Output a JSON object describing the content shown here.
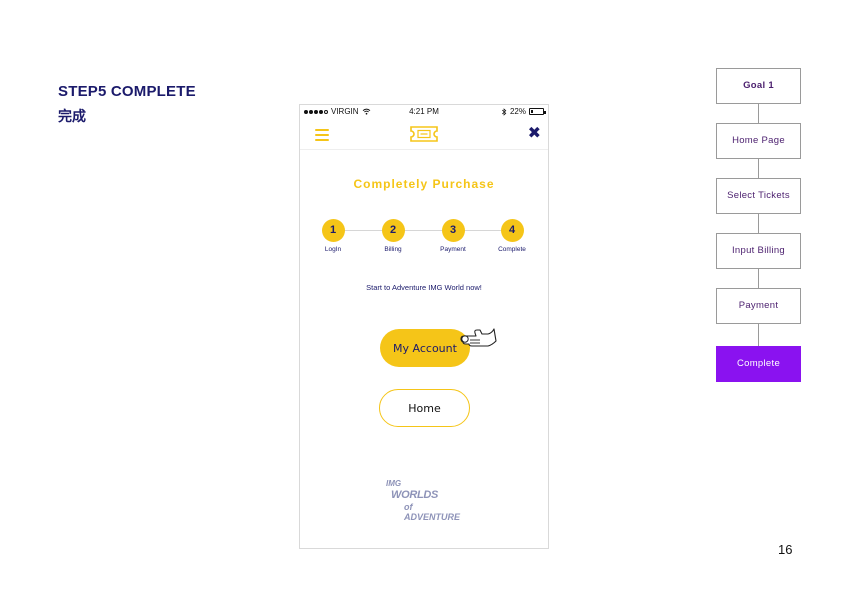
{
  "slide": {
    "title": "STEP5 COMPLETE",
    "subtitle": "完成",
    "page_number": "16"
  },
  "phone": {
    "status_bar": {
      "carrier": "VIRGIN",
      "time": "4:21 PM",
      "battery": "22%",
      "battery_level": 0.22
    },
    "heading": "Completely Purchase",
    "steps": [
      {
        "number": "1",
        "label": "LogIn"
      },
      {
        "number": "2",
        "label": "Billing"
      },
      {
        "number": "3",
        "label": "Payment"
      },
      {
        "number": "4",
        "label": "Complete"
      }
    ],
    "tagline": "Start to Adventure IMG World now!",
    "primary_button": "My Account",
    "secondary_button": "Home",
    "brand": {
      "line1": "IMG",
      "line2": "WORLDS",
      "line3": "of ADVENTURE"
    },
    "icons": {
      "menu": "hamburger-menu-icon",
      "logo": "ticket-icon",
      "close": "close-icon",
      "pointer": "hand-pointer-icon"
    }
  },
  "flow": [
    {
      "label": "Goal 1",
      "state": "goal"
    },
    {
      "label": "Home Page",
      "state": "normal"
    },
    {
      "label": "Select Tickets",
      "state": "normal"
    },
    {
      "label": "Input Billing",
      "state": "normal"
    },
    {
      "label": "Payment",
      "state": "normal"
    },
    {
      "label": "Complete",
      "state": "active"
    }
  ],
  "colors": {
    "accent_yellow": "#f5c518",
    "navy": "#1b1a6b",
    "active_purple": "#8a12f0",
    "flow_text": "#4b1f6e"
  }
}
